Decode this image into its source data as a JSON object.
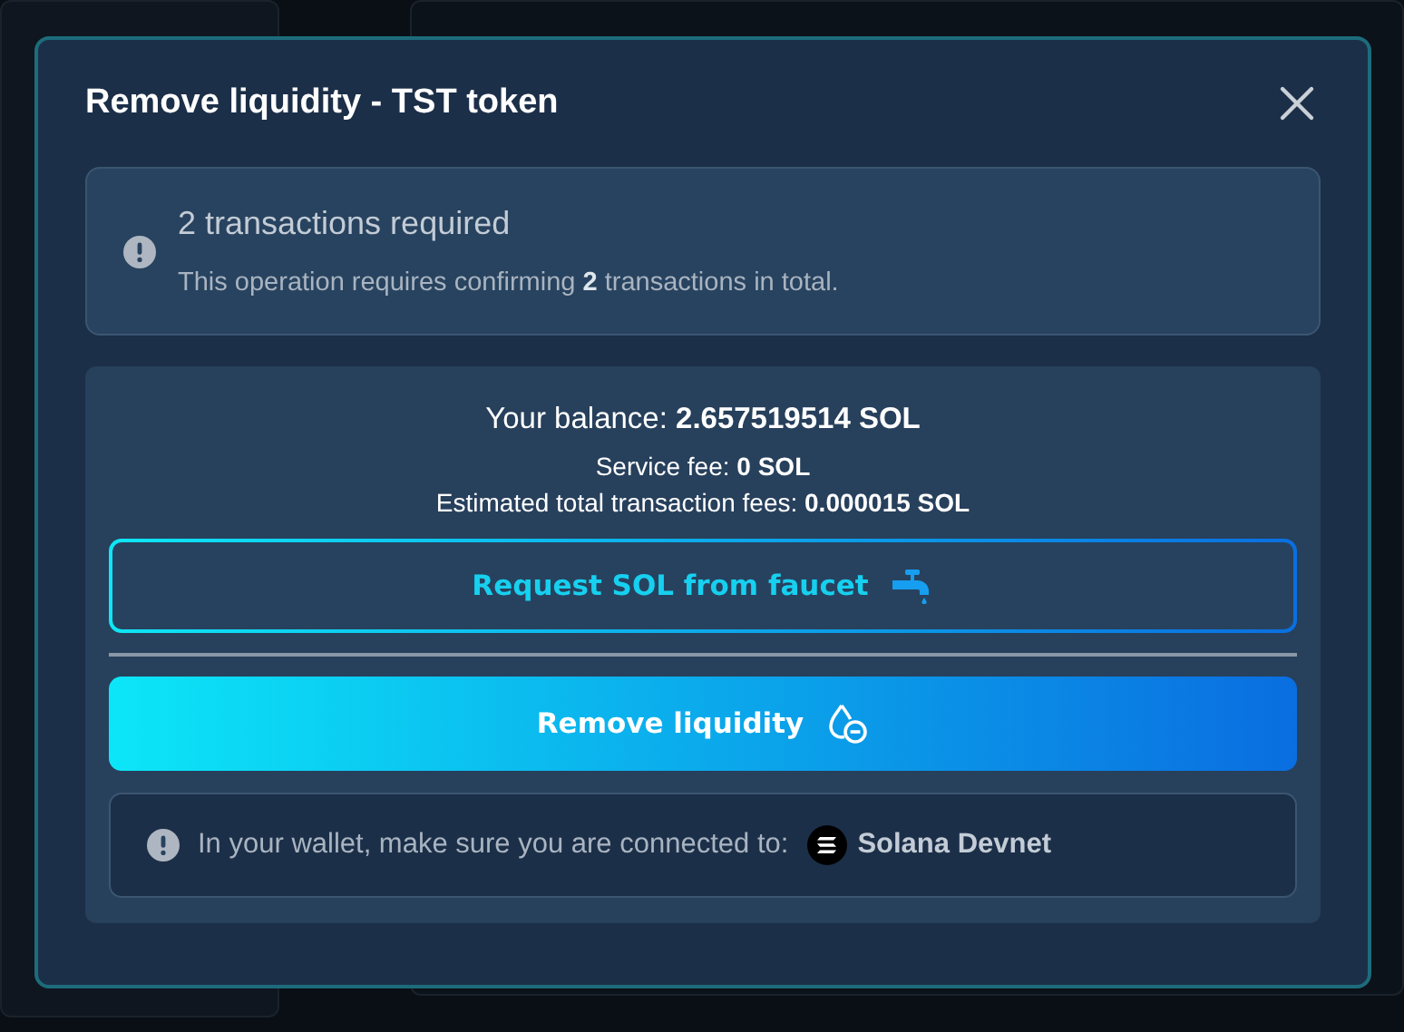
{
  "dialog": {
    "title": "Remove liquidity - TST token"
  },
  "notice": {
    "title": "2 transactions required",
    "text": "This operation requires confirming **2** transactions in total."
  },
  "balance": {
    "text": "Your balance: **2.657519514 SOL**",
    "service_fee": "Service fee: **0 SOL**",
    "estimated_fees": "Estimated total transaction fees: **0.000015 SOL**"
  },
  "buttons": [
    {
      "kind": "outline",
      "label": "Request SOL from faucet"
    },
    {
      "kind": "primary",
      "label": "Remove liquidity"
    }
  ],
  "network_notice": {
    "text": "In your wallet, make sure you are connected to:",
    "network": "Solana Devnet"
  }
}
